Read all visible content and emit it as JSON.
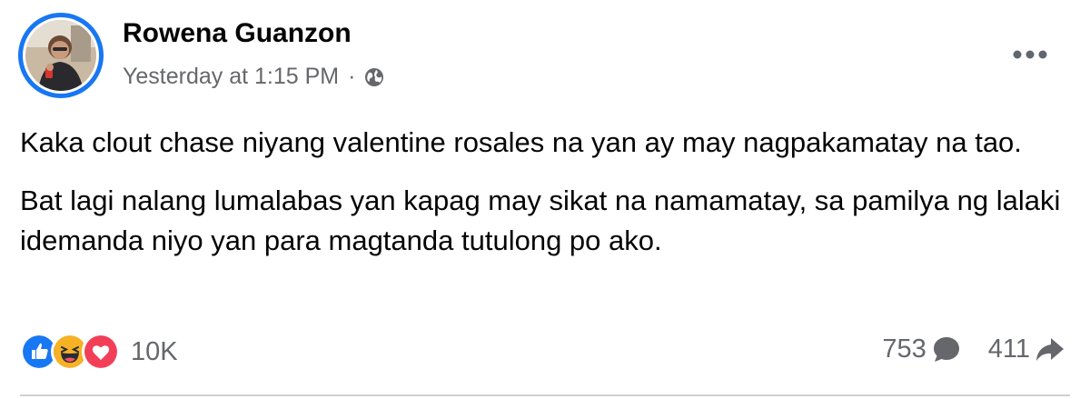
{
  "post": {
    "author": "Rowena Guanzon",
    "timestamp": "Yesterday at 1:15 PM",
    "separator": "·",
    "audience_icon": "globe-icon",
    "more_icon": "more-options-icon",
    "paragraphs": [
      "Kaka clout chase niyang valentine rosales na yan ay may nagpakamatay na tao.",
      "Bat lagi nalang lumalabas yan kapag may sikat na namamatay, sa pamilya ng lalaki idemanda niyo yan para magtanda tutulong po ako."
    ]
  },
  "reactions": {
    "icons": [
      "like-reaction-icon",
      "haha-reaction-icon",
      "love-reaction-icon"
    ],
    "count": "10K"
  },
  "stats": {
    "comments": "753",
    "comment_icon": "comment-bubble-icon",
    "shares": "411",
    "share_icon": "share-arrow-icon"
  },
  "colors": {
    "brand_blue": "#1877f2",
    "secondary_text": "#65676b",
    "love_red": "#f33e58",
    "haha_yellow": "#f7b125"
  }
}
